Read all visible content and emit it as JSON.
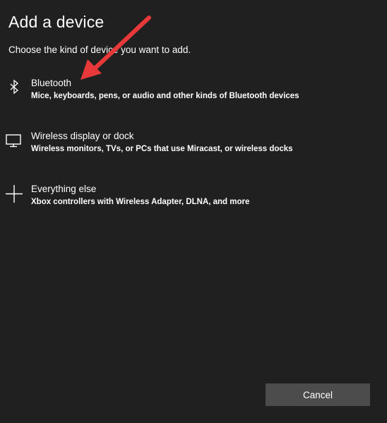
{
  "dialog": {
    "title": "Add a device",
    "subtitle": "Choose the kind of device you want to add."
  },
  "options": [
    {
      "name": "Bluetooth",
      "description": "Mice, keyboards, pens, or audio and other kinds of Bluetooth devices",
      "icon": "bluetooth-icon"
    },
    {
      "name": "Wireless display or dock",
      "description": "Wireless monitors, TVs, or PCs that use Miracast, or wireless docks",
      "icon": "monitor-icon"
    },
    {
      "name": "Everything else",
      "description": "Xbox controllers with Wireless Adapter, DLNA, and more",
      "icon": "plus-icon"
    }
  ],
  "buttons": {
    "cancel": "Cancel"
  },
  "annotation": {
    "arrow_color": "#e8393a",
    "points_to": "Bluetooth"
  }
}
